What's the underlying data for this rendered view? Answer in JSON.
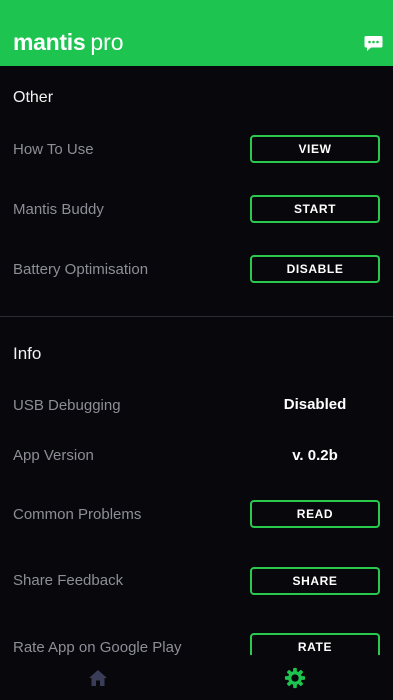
{
  "app": {
    "brand_bold": "mantis",
    "brand_light": "pro",
    "header_icon": "chat-icon"
  },
  "colors": {
    "accent": "#1dc44f",
    "button_border": "#28c94c",
    "background": "#07070c",
    "label": "#8d8e96",
    "home_icon": "#3a3d57"
  },
  "other": {
    "title": "Other",
    "rows": [
      {
        "label": "How To Use",
        "button": "VIEW"
      },
      {
        "label": "Mantis Buddy",
        "button": "START"
      },
      {
        "label": "Battery Optimisation",
        "button": "DISABLE"
      }
    ]
  },
  "info": {
    "title": "Info",
    "usb": {
      "label": "USB Debugging",
      "value": "Disabled"
    },
    "version": {
      "label": "App Version",
      "value": "v. 0.2b"
    },
    "problems": {
      "label": "Common Problems",
      "button": "READ"
    },
    "feedback": {
      "label": "Share Feedback",
      "button": "SHARE"
    },
    "rate": {
      "label": "Rate App on Google Play",
      "button": "RATE"
    }
  },
  "tabbar": {
    "items": [
      {
        "icon": "home-icon",
        "active": false
      },
      {
        "icon": "gear-icon",
        "active": true
      }
    ]
  }
}
